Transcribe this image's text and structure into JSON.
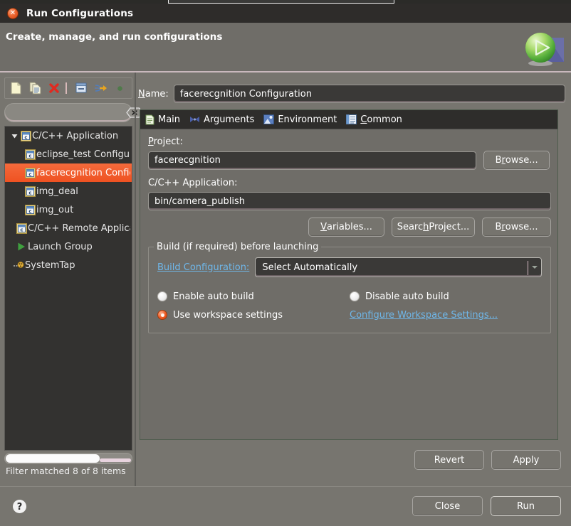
{
  "window": {
    "title": "Run Configurations",
    "close_icon": "close-icon",
    "header_description": "Create, manage, and run configurations",
    "header_icon": "run-launch-icon"
  },
  "toolbar": {
    "buttons": [
      {
        "name": "new-configuration-icon",
        "label": "New"
      },
      {
        "name": "duplicate-configuration-icon",
        "label": "Duplicate"
      },
      {
        "name": "delete-configuration-icon",
        "label": "Delete"
      },
      {
        "name": "collapse-all-icon",
        "label": "Collapse All"
      },
      {
        "name": "filter-export-icon",
        "label": "Filter"
      },
      {
        "name": "dot-indicator-icon",
        "label": ""
      }
    ]
  },
  "filter": {
    "value": "",
    "placeholder": "",
    "clear_icon": "clear-filter-icon",
    "status": "Filter matched 8 of 8 items"
  },
  "tree": {
    "items": [
      {
        "label": "C/C++ Application",
        "icon": "c-application-icon",
        "indent": 0,
        "expander": "expanded",
        "selected": false
      },
      {
        "label": "eclipse_test Configura",
        "icon": "c-application-icon",
        "indent": 1,
        "expander": "none",
        "selected": false
      },
      {
        "label": "facerecgnition Configu",
        "icon": "c-application-icon",
        "indent": 1,
        "expander": "none",
        "selected": true
      },
      {
        "label": "img_deal",
        "icon": "c-application-icon",
        "indent": 1,
        "expander": "none",
        "selected": false
      },
      {
        "label": "img_out",
        "icon": "c-application-icon",
        "indent": 1,
        "expander": "none",
        "selected": false
      },
      {
        "label": "C/C++ Remote Applicati",
        "icon": "c-application-icon",
        "indent": 0,
        "expander": "none",
        "selected": false
      },
      {
        "label": "Launch Group",
        "icon": "launch-group-icon",
        "indent": 0,
        "expander": "none",
        "selected": false
      },
      {
        "label": "SystemTap",
        "icon": "systemtap-icon",
        "indent": 0,
        "expander": "none",
        "selected": false
      }
    ]
  },
  "form": {
    "name_label_prefix": "N",
    "name_label_rest": "ame:",
    "name_value": "facerecgnition Configuration",
    "tabs": [
      {
        "label": "Main",
        "icon": "main-tab-icon",
        "mnemonic": "",
        "active": true
      },
      {
        "label": "Arguments",
        "icon": "arguments-tab-icon",
        "mnemonic": "",
        "active": false
      },
      {
        "label": "Environment",
        "icon": "environment-tab-icon",
        "mnemonic": "",
        "active": false
      },
      {
        "label": "Common",
        "icon": "common-tab-icon",
        "mnemonic": "C",
        "active": false
      }
    ],
    "project_label_prefix": "P",
    "project_label_rest": "roject:",
    "project_value": "facerecgnition",
    "project_browse_prefix": "B",
    "project_browse_mnemonic": "r",
    "project_browse_rest": "owse...",
    "application_label": "C/C++ Application:",
    "application_value": "bin/camera_publish",
    "variables_prefix": "V",
    "variables_rest": "ariables...",
    "search_project_pre": "Searc",
    "search_project_mnemonic": "h",
    "search_project_post": " Project...",
    "app_browse_pre": "B",
    "app_browse_mnemonic": "r",
    "app_browse_post": "owse..."
  },
  "build_group": {
    "title": "Build (if required) before launching",
    "build_configuration_link": "Build Configuration:",
    "build_configuration_value": "Select Automatically",
    "radios": [
      {
        "label": "Enable auto build",
        "selected": false
      },
      {
        "label": "Disable auto build",
        "selected": false
      },
      {
        "label": "Use workspace settings",
        "selected": true
      }
    ],
    "configure_workspace_link": "Configure Workspace Settings..."
  },
  "actions": {
    "revert": "Revert",
    "apply": "Apply",
    "close": "Close",
    "run": "Run",
    "help_icon": "help-icon"
  },
  "colors": {
    "selection_orange": "#ef5222",
    "link_blue": "#6fb6e8",
    "panel_gray": "#77756f",
    "tree_background": "#333230",
    "titlebar": "#2e2c2a"
  }
}
